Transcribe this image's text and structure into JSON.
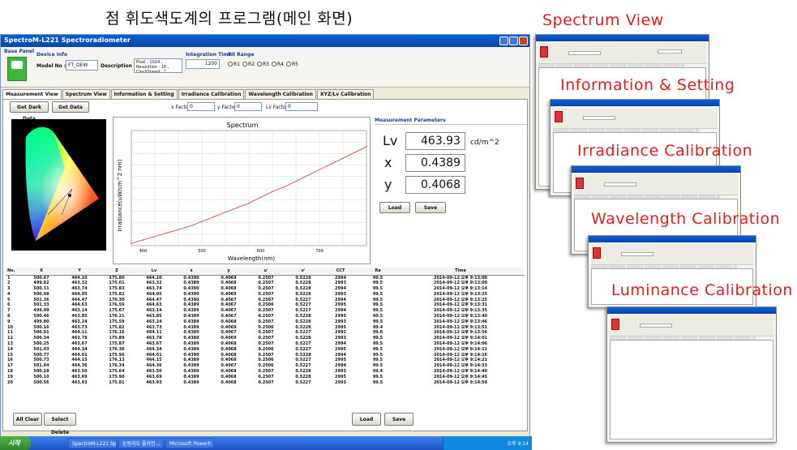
{
  "slide_title": "점 휘도색도계의 프로그램(메인 화면)",
  "window": {
    "title": "SpectroM-L221 Spectroradiometer",
    "base_panel": "Base Panel",
    "device_info": "Device Info",
    "model_no_label": "Model No :",
    "model_no_value": "FT_DEW",
    "description_label": "Description",
    "description_value": "Pixel : 1024 , Resoultion : 16 , ClockSpeed : 1",
    "integration_time_label": "Integration Time",
    "integration_time_value": "1200",
    "fit_range_label": "Fit Range",
    "fit_range_options": [
      "R1",
      "R2",
      "R3",
      "R4",
      "R5"
    ]
  },
  "tabs": [
    "Measurement View",
    "Spectrum View",
    "Information & Setting",
    "Irradiance Calibration",
    "Wavelength Calibration",
    "XYZ/Lv Calibration"
  ],
  "toolbar": {
    "get_dark_data": "Get Dark Data",
    "get_data": "Get Data",
    "x_factor_label": "x Factor",
    "x_factor_value": "0",
    "y_factor_label": "y Factor",
    "y_factor_value": "0",
    "lv_factor_label": "Lv Factor",
    "lv_factor_value": "0"
  },
  "spectrum_chart": {
    "title": "Spectrum",
    "xlabel": "Wavelength(nm)",
    "ylabel": "Irradiance(uW/cm^2 nm)",
    "xticks": [
      "400",
      "500",
      "600",
      "700"
    ]
  },
  "chart_data": {
    "type": "line",
    "title": "Spectrum",
    "xlabel": "Wavelength(nm)",
    "ylabel": "Irradiance(uW/cm^2 nm)",
    "x": [
      380,
      400,
      420,
      440,
      460,
      480,
      500,
      520,
      540,
      560,
      580,
      600,
      620,
      640,
      660,
      680,
      700,
      720,
      740,
      760,
      780
    ],
    "y": [
      0.02,
      0.05,
      0.08,
      0.11,
      0.14,
      0.17,
      0.21,
      0.25,
      0.29,
      0.33,
      0.37,
      0.42,
      0.47,
      0.51,
      0.56,
      0.61,
      0.66,
      0.71,
      0.76,
      0.81,
      0.86
    ],
    "xlim": [
      380,
      780
    ],
    "ylim": [
      0,
      1
    ],
    "grid": true
  },
  "measurement": {
    "title": "Measurement Parameters",
    "lv_label": "Lv",
    "lv_value": "463.93",
    "lv_unit": "cd/m^2",
    "x_label": "x",
    "x_value": "0.4389",
    "y_label": "y",
    "y_value": "0.4068",
    "load": "Load",
    "save": "Save"
  },
  "table": {
    "headers": [
      "No.",
      "X",
      "Y",
      "Z",
      "Lv",
      "x",
      "y",
      "u'",
      "v'",
      "CCT",
      "Ra",
      "Time"
    ],
    "rows": [
      [
        "1",
        "500.67",
        "464.10",
        "175.80",
        "464.10",
        "0.4390",
        "0.4069",
        "0.2507",
        "0.5228",
        "2994",
        "99.5",
        "2014-09-12 오후 9:13:00"
      ],
      [
        "2",
        "499.02",
        "463.32",
        "175.01",
        "463.32",
        "0.4389",
        "0.4068",
        "0.2507",
        "0.5228",
        "2993",
        "99.5",
        "2014-09-12 오후 9:13:00"
      ],
      [
        "3",
        "500.31",
        "463.74",
        "175.83",
        "463.74",
        "0.4390",
        "0.4068",
        "0.2507",
        "0.5228",
        "2994",
        "99.5",
        "2014-09-12 오후 9:13:14"
      ],
      [
        "4",
        "500.08",
        "464.05",
        "175.82",
        "464.05",
        "0.4390",
        "0.4069",
        "0.2507",
        "0.5228",
        "2993",
        "99.5",
        "2014-09-12 오후 9:13:25"
      ],
      [
        "5",
        "501.36",
        "464.47",
        "176.30",
        "464.47",
        "0.4390",
        "0.4067",
        "0.2507",
        "0.5227",
        "2994",
        "99.5",
        "2014-09-12 오후 9:13:25"
      ],
      [
        "6",
        "501.33",
        "464.63",
        "176.56",
        "464.63",
        "0.4389",
        "0.4067",
        "0.2506",
        "0.5227",
        "2995",
        "99.5",
        "2014-09-12 오후 9:13:31"
      ],
      [
        "7",
        "499.09",
        "463.14",
        "175.67",
        "463.14",
        "0.4389",
        "0.4067",
        "0.2507",
        "0.5227",
        "2994",
        "99.5",
        "2014-09-12 오후 9:13:35"
      ],
      [
        "8",
        "500.46",
        "463.85",
        "176.21",
        "463.85",
        "0.4389",
        "0.4067",
        "0.2507",
        "0.5228",
        "2995",
        "99.5",
        "2014-09-12 오후 9:13:40"
      ],
      [
        "9",
        "499.80",
        "463.24",
        "175.59",
        "463.24",
        "0.4389",
        "0.4068",
        "0.2507",
        "0.5228",
        "2993",
        "99.5",
        "2014-09-12 오후 9:13:46"
      ],
      [
        "10",
        "500.16",
        "463.73",
        "175.82",
        "463.73",
        "0.4389",
        "0.4069",
        "0.2506",
        "0.5228",
        "2995",
        "99.4",
        "2014-09-12 오후 9:13:51"
      ],
      [
        "11",
        "500.91",
        "464.11",
        "176.16",
        "464.11",
        "0.4389",
        "0.4067",
        "0.2507",
        "0.5227",
        "2992",
        "99.6",
        "2014-09-12 오후 9:13:56"
      ],
      [
        "12",
        "500.34",
        "463.78",
        "175.89",
        "463.78",
        "0.4389",
        "0.4069",
        "0.2507",
        "0.5228",
        "2993",
        "99.5",
        "2014-09-12 오후 9:14:01"
      ],
      [
        "13",
        "500.25",
        "463.67",
        "175.87",
        "463.67",
        "0.4389",
        "0.4068",
        "0.2507",
        "0.5227",
        "2994",
        "99.5",
        "2014-09-12 오후 9:14:06"
      ],
      [
        "14",
        "501.03",
        "464.34",
        "176.36",
        "464.34",
        "0.4389",
        "0.4068",
        "0.2506",
        "0.5227",
        "2995",
        "99.5",
        "2014-09-12 오후 9:14:11"
      ],
      [
        "15",
        "500.77",
        "464.01",
        "175.96",
        "464.01",
        "0.4390",
        "0.4068",
        "0.2507",
        "0.5228",
        "2994",
        "99.5",
        "2014-09-12 오후 9:14:16"
      ],
      [
        "16",
        "500.73",
        "464.15",
        "176.13",
        "464.15",
        "0.4389",
        "0.4068",
        "0.2506",
        "0.5227",
        "2995",
        "99.5",
        "2014-09-12 오후 9:14:21"
      ],
      [
        "17",
        "501.04",
        "464.36",
        "176.34",
        "464.36",
        "0.4389",
        "0.4067",
        "0.2506",
        "0.5227",
        "2994",
        "99.5",
        "2014-09-12 오후 9:14:33"
      ],
      [
        "18",
        "500.18",
        "463.50",
        "175.64",
        "463.50",
        "0.4389",
        "0.4068",
        "0.2507",
        "0.5228",
        "2993",
        "99.4",
        "2014-09-12 오후 9:14:40"
      ],
      [
        "19",
        "500.10",
        "463.69",
        "175.90",
        "463.69",
        "0.4389",
        "0.4068",
        "0.2507",
        "0.5228",
        "2995",
        "99.5",
        "2014-09-12 오후 9:14:45"
      ],
      [
        "20",
        "500.56",
        "463.93",
        "175.81",
        "463.93",
        "0.4389",
        "0.4068",
        "0.2507",
        "0.5227",
        "2993",
        "99.5",
        "2014-09-12 오후 9:14:50"
      ]
    ]
  },
  "bottom_buttons": {
    "all_clear": "All Clear",
    "select_delete": "Select Delete",
    "load": "Load",
    "save": "Save"
  },
  "taskbar": {
    "start": "시작",
    "tasks": [
      "SpectroM-L221 Sp...",
      "눈동리도 플라인...",
      "Microsoft PowerP..."
    ],
    "clock": "오후 9:14"
  },
  "views": [
    "Spectrum View",
    "Information & Setting",
    "Irradiance Calibration",
    "Wavelength Calibration",
    "Luminance Calibration"
  ],
  "colors": {
    "accent_label": "#e31d1d",
    "title_bar": "#0a5fd8",
    "spectrum_line": "#e03030"
  }
}
